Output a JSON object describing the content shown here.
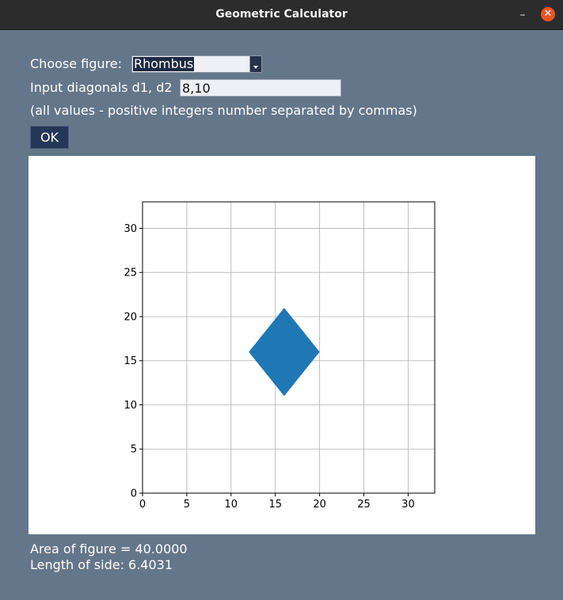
{
  "window": {
    "title": "Geometric Calculator",
    "minimize_glyph": "–",
    "close_glyph": "✕"
  },
  "form": {
    "figure_label": "Choose figure:",
    "figure_selected": "Rhombus",
    "diagonals_label": "Input diagonals d1, d2",
    "diagonals_value": "8,10",
    "hint": "(all values - positive integers number separated by commas)",
    "ok_label": "OK"
  },
  "results": {
    "area_text": "Area of figure = 40.0000",
    "side_text": "Length of side: 6.4031"
  },
  "chart_data": {
    "type": "area",
    "shape": "rhombus",
    "polygon": [
      [
        12,
        16
      ],
      [
        16,
        21
      ],
      [
        20,
        16
      ],
      [
        16,
        11
      ]
    ],
    "fill_color": "#1f77b4",
    "xlim": [
      0,
      33
    ],
    "ylim": [
      0,
      33
    ],
    "xticks": [
      0,
      5,
      10,
      15,
      20,
      25,
      30
    ],
    "yticks": [
      0,
      5,
      10,
      15,
      20,
      25,
      30
    ],
    "grid": true
  },
  "colors": {
    "window_bg": "#64768a",
    "titlebar_bg": "#2c2c2c",
    "close_button": "#e95420",
    "ok_button_bg": "#243757"
  }
}
